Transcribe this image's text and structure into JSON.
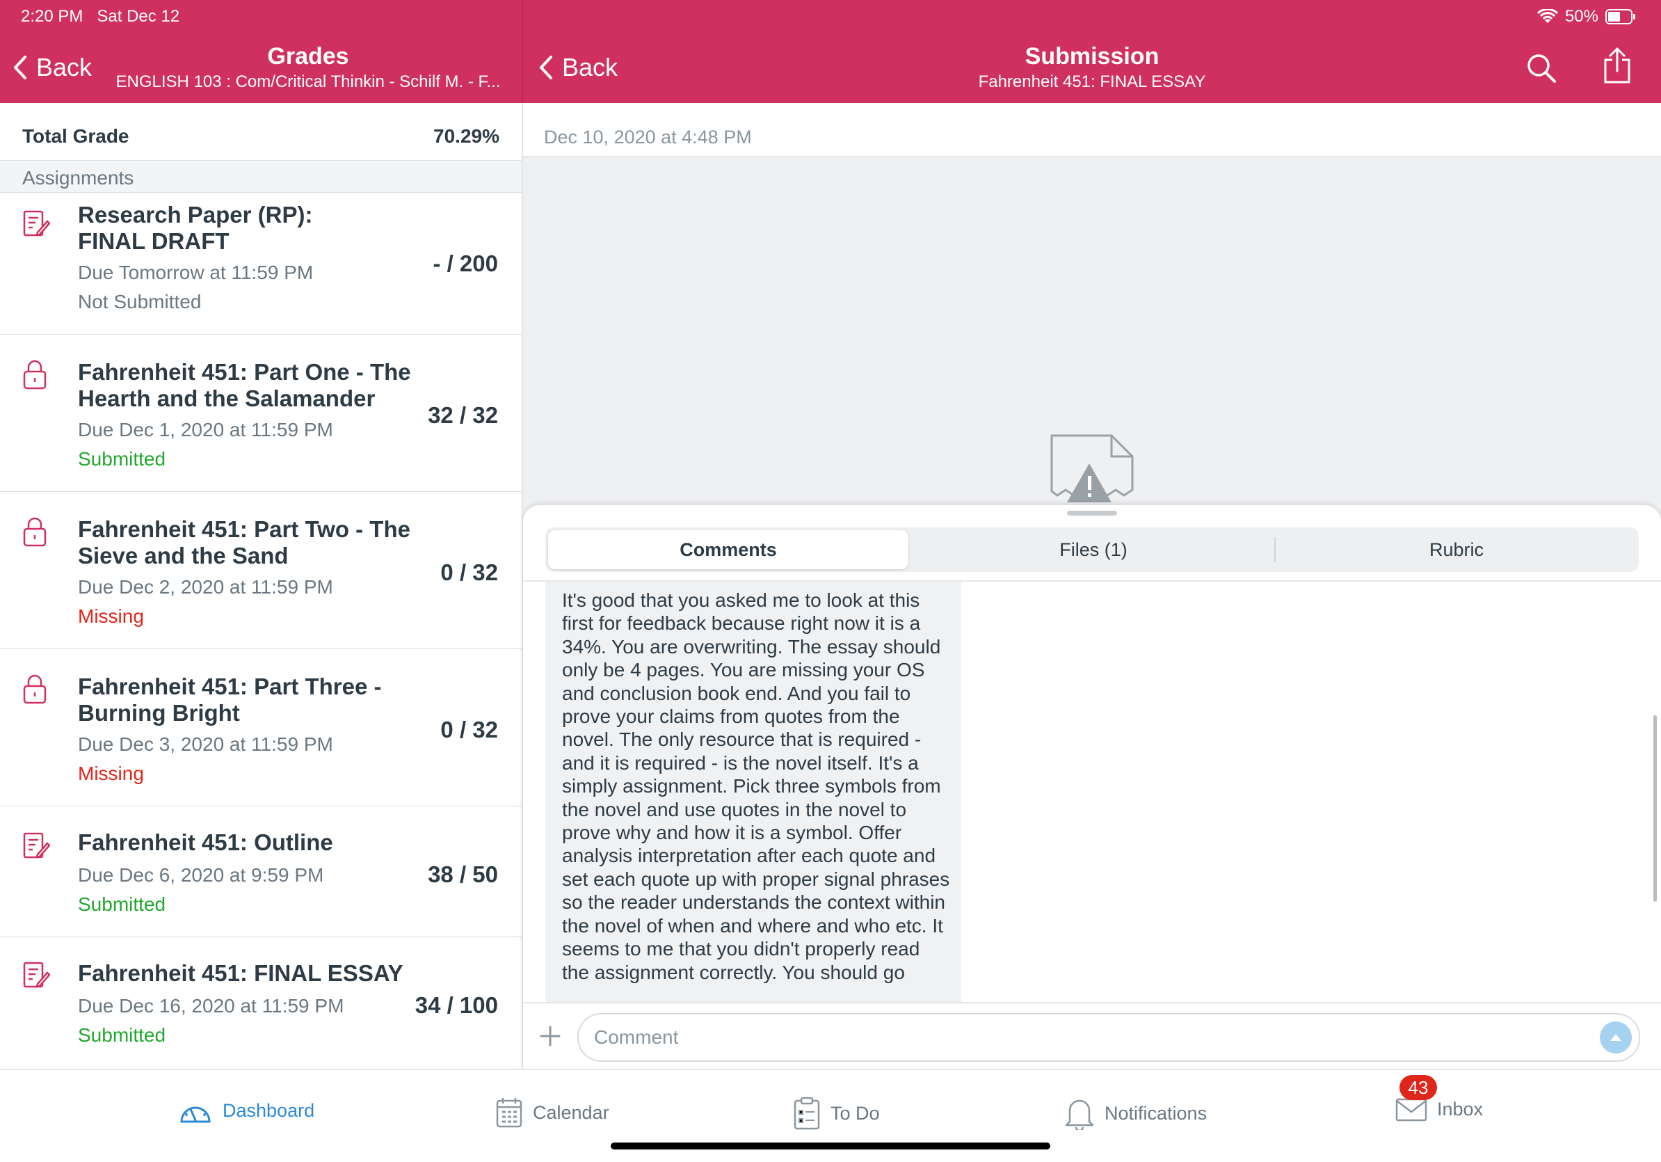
{
  "status": {
    "time": "2:20 PM",
    "date": "Sat Dec 12",
    "battery": "50%"
  },
  "left_header": {
    "back": "Back",
    "title": "Grades",
    "subtitle": "ENGLISH 103 : Com/Critical Thinkin - Schilf M. - F..."
  },
  "right_header": {
    "back": "Back",
    "title": "Submission",
    "subtitle": "Fahrenheit 451: FINAL ESSAY"
  },
  "total": {
    "label": "Total Grade",
    "value": "70.29%"
  },
  "section": "Assignments",
  "assignments": [
    {
      "icon": "assignment-icon",
      "name1": "Research Paper (RP):",
      "name2": "FINAL DRAFT",
      "due": "Due Tomorrow at 11:59 PM",
      "state": "Not Submitted",
      "score": "- / 200"
    },
    {
      "icon": "lock-icon",
      "name1": "Fahrenheit 451: Part One - The",
      "name2": "Hearth and the Salamander",
      "due": "Due Dec 1, 2020 at 11:59 PM",
      "state": "Submitted",
      "score": "32 / 32"
    },
    {
      "icon": "lock-icon",
      "name1": "Fahrenheit 451: Part Two - The",
      "name2": "Sieve and the Sand",
      "due": "Due Dec 2, 2020 at 11:59 PM",
      "state": "Missing",
      "score": "0 / 32"
    },
    {
      "icon": "lock-icon",
      "name1": "Fahrenheit 451: Part Three -",
      "name2": "Burning Bright",
      "due": "Due Dec 3, 2020 at 11:59 PM",
      "state": "Missing",
      "score": "0 / 32"
    },
    {
      "icon": "assignment-icon",
      "name1": "Fahrenheit 451: Outline",
      "name2": "",
      "due": "Due Dec 6, 2020 at 9:59 PM",
      "state": "Submitted",
      "score": "38 / 50"
    },
    {
      "icon": "assignment-icon",
      "name1": "Fahrenheit 451: FINAL ESSAY",
      "name2": "",
      "due": "Due Dec 16, 2020 at 11:59 PM",
      "state": "Submitted",
      "score": "34 / 100"
    }
  ],
  "submission": {
    "date": "Dec 10, 2020 at 4:48 PM",
    "tabs": [
      "Comments",
      "Files (1)",
      "Rubric"
    ],
    "comment_text": "It's good that you asked me to look at this first for feedback because right now it is a 34%. You are overwriting. The essay should only be 4 pages. You are missing your OS and conclusion book end. And you fail to prove your claims from quotes from the novel. The only resource that is required - and it is required - is the novel itself. It's a simply assignment. Pick three symbols from the novel and use quotes in the novel to prove why and how it is a symbol. Offer analysis interpretation after each quote and set each quote up with proper signal phrases so the reader understands the context within the novel of when and where and who etc.  It seems to me that you didn't properly read the assignment correctly. You should go",
    "comment_placeholder": "Comment"
  },
  "tabbar": [
    {
      "label": "Dashboard",
      "icon": "dashboard-icon",
      "active": true
    },
    {
      "label": "Calendar",
      "icon": "calendar-icon"
    },
    {
      "label": "To Do",
      "icon": "todo-icon"
    },
    {
      "label": "Notifications",
      "icon": "bell-icon"
    },
    {
      "label": "Inbox",
      "icon": "inbox-icon",
      "badge": "43"
    }
  ],
  "colors": {
    "brand": "#d0305f",
    "active_tab": "#2b8ad7",
    "submitted": "#20a82d",
    "missing": "#e0261b"
  }
}
